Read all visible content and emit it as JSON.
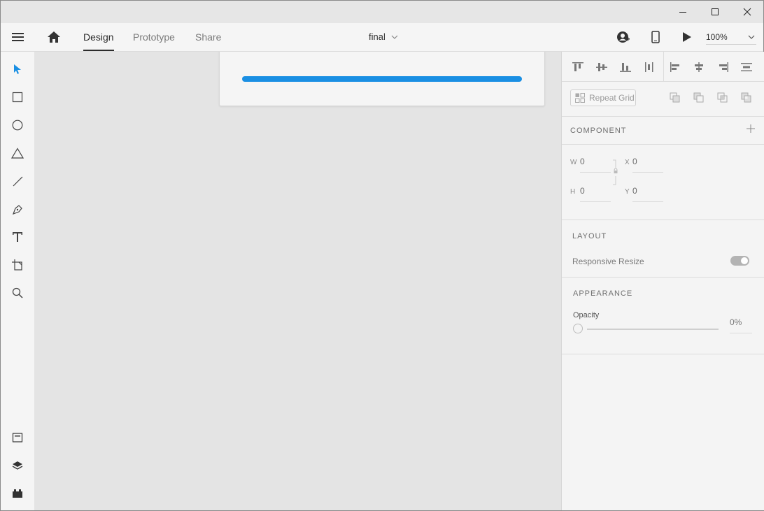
{
  "titlebar": {
    "minimize_icon": "minimize-icon",
    "maximize_icon": "maximize-icon",
    "close_icon": "close-icon"
  },
  "topbar": {
    "menu_icon": "hamburger-icon",
    "home_icon": "home-icon",
    "tabs": [
      {
        "label": "Design",
        "active": true
      },
      {
        "label": "Prototype",
        "active": false
      },
      {
        "label": "Share",
        "active": false
      }
    ],
    "document_title": "final",
    "zoom": "100%"
  },
  "tools": [
    "select-icon",
    "rectangle-icon",
    "ellipse-icon",
    "polygon-icon",
    "line-icon",
    "pen-icon",
    "text-icon",
    "artboard-icon",
    "zoom-icon"
  ],
  "bottom_tools": [
    "assets-icon",
    "layers-icon",
    "plugins-icon"
  ],
  "right_panel": {
    "repeat_grid": "Repeat Grid",
    "component_heading": "COMPONENT",
    "w_label": "W",
    "w_value": "0",
    "h_label": "H",
    "h_value": "0",
    "x_label": "X",
    "x_value": "0",
    "y_label": "Y",
    "y_value": "0",
    "layout_heading": "LAYOUT",
    "responsive_resize": "Responsive Resize",
    "appearance_heading": "APPEARANCE",
    "opacity_label": "Opacity",
    "opacity_value": "0%"
  },
  "colors": {
    "accent": "#1a8fe3",
    "select_tool": "#1a8fe3"
  }
}
